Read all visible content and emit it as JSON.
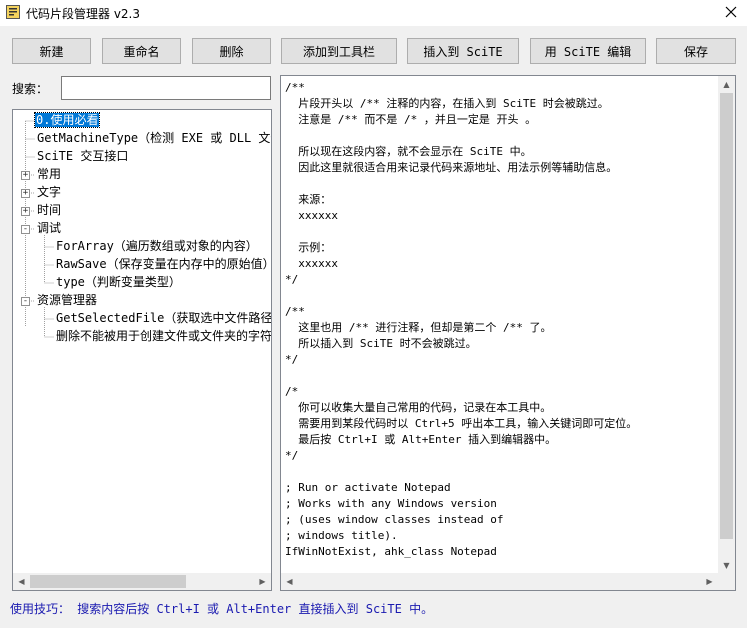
{
  "window": {
    "title": "代码片段管理器 v2.3"
  },
  "toolbar": {
    "new": "新建",
    "rename": "重命名",
    "delete": "删除",
    "add_to_toolbar": "添加到工具栏",
    "insert_to_scite": "插入到 SciTE",
    "edit_with_scite": "用 SciTE 编辑",
    "save": "保存"
  },
  "search": {
    "label": "搜索：",
    "value": ""
  },
  "tree": {
    "items": [
      {
        "label": "0.使用必看",
        "selected": true
      },
      {
        "label": "GetMachineType（检测 EXE 或 DLL 文件"
      },
      {
        "label": "SciTE 交互接口"
      },
      {
        "label": "常用",
        "expander": "+"
      },
      {
        "label": "文字",
        "expander": "+"
      },
      {
        "label": "时间",
        "expander": "+"
      },
      {
        "label": "调试",
        "expander": "-"
      },
      {
        "label": "ForArray（遍历数组或对象的内容）"
      },
      {
        "label": "RawSave（保存变量在内存中的原始值）"
      },
      {
        "label": "type（判断变量类型）"
      },
      {
        "label": "资源管理器",
        "expander": "-"
      },
      {
        "label": "GetSelectedFile（获取选中文件路径"
      },
      {
        "label": "删除不能被用于创建文件或文件夹的字符"
      }
    ]
  },
  "editor": {
    "content": "/**\n  片段开头以 /** 注释的内容，在插入到 SciTE 时会被跳过。\n  注意是 /** 而不是 /* ，并且一定是 开头 。\n\n  所以现在这段内容，就不会显示在 SciTE 中。\n  因此这里就很适合用来记录代码来源地址、用法示例等辅助信息。\n\n  来源：\n  xxxxxx\n\n  示例：\n  xxxxxx\n*/\n\n/**\n  这里也用 /** 进行注释，但却是第二个 /** 了。\n  所以插入到 SciTE 时不会被跳过。\n*/\n\n/*\n  你可以收集大量自己常用的代码，记录在本工具中。\n  需要用到某段代码时以 Ctrl+5 呼出本工具，输入关键词即可定位。\n  最后按 Ctrl+I 或 Alt+Enter 插入到编辑器中。\n*/\n\n; Run or activate Notepad\n; Works with any Windows version\n; (uses window classes instead of\n; windows title).\nIfWinNotExist, ahk_class Notepad"
  },
  "status": {
    "tip": "使用技巧： 搜索内容后按 Ctrl+I 或 Alt+Enter 直接插入到 SciTE 中。"
  }
}
